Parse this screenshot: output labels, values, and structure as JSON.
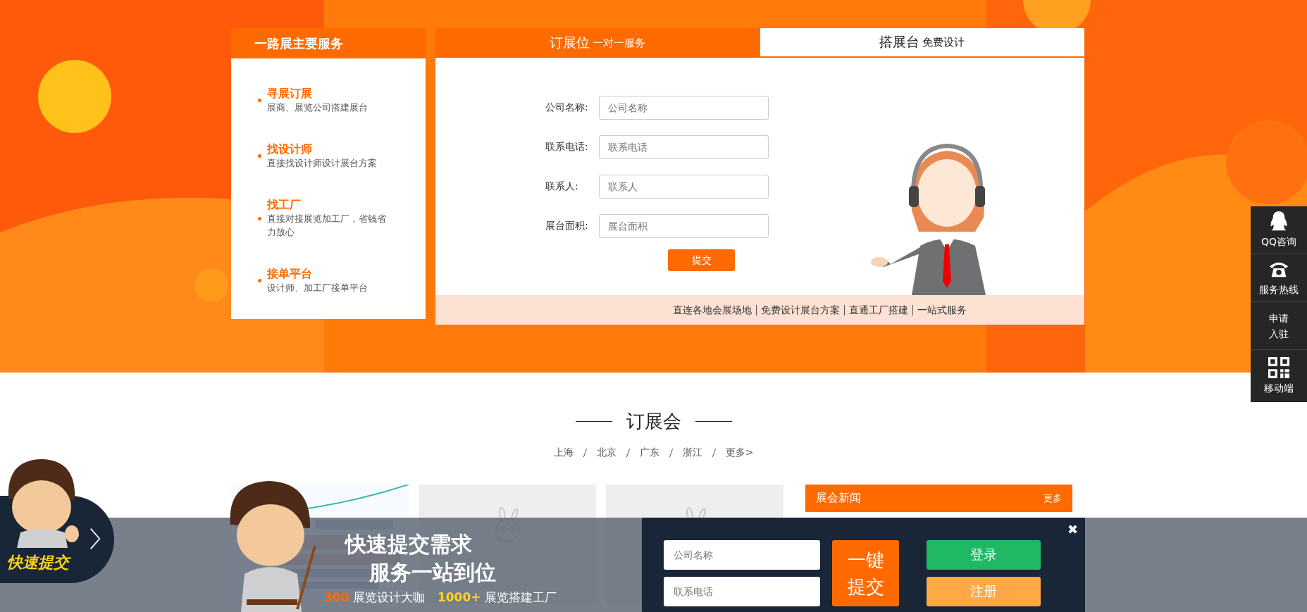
{
  "services_panel": {
    "title": "一路展主要服务",
    "items": [
      {
        "title": "寻展订展",
        "desc": "展商、展览公司搭建展台"
      },
      {
        "title": "找设计师",
        "desc": "直接找设计师设计展台方案"
      },
      {
        "title": "找工厂",
        "desc": "直接对接展览加工厂，省钱省力放心"
      },
      {
        "title": "接单平台",
        "desc": "设计师、加工厂接单平台"
      }
    ]
  },
  "booking_panel": {
    "tabs": [
      {
        "label": "订展位",
        "sub": "一对一服务",
        "selected": false
      },
      {
        "label": "搭展台",
        "sub": "免费设计",
        "selected": true
      }
    ],
    "fields": [
      {
        "label": "公司名称:",
        "placeholder": "公司名称"
      },
      {
        "label": "联系电话:",
        "placeholder": "联系电话"
      },
      {
        "label": "联系人:",
        "placeholder": "联系人"
      },
      {
        "label": "展台面积:",
        "placeholder": "展台面积"
      }
    ],
    "submit": "提交",
    "footer": [
      "直连各地会展场地",
      "免费设计展台方案",
      "直通工厂搭建",
      "一站式服务"
    ]
  },
  "side_bar": [
    {
      "kind": "qq",
      "lines": [
        "QQ咨询"
      ]
    },
    {
      "kind": "phone",
      "lines": [
        "服务热线"
      ]
    },
    {
      "kind": "text",
      "lines": [
        "申请",
        "入驻"
      ]
    },
    {
      "kind": "qrcode",
      "lines": [
        "移动端"
      ]
    }
  ],
  "section": {
    "title": "订展会",
    "cities": [
      "上海",
      "北京",
      "广东",
      "浙江",
      "更多>"
    ]
  },
  "cards": [
    {
      "kind": "picture"
    },
    {
      "kind": "placeholder"
    },
    {
      "kind": "placeholder"
    }
  ],
  "news": {
    "title": "展会新闻",
    "more": "更多"
  },
  "quick_bar": {
    "badge": "快速提交",
    "headline": [
      "快速提交需求",
      "服务一站到位"
    ],
    "stats": [
      {
        "number": "300",
        "label": "展览设计大咖",
        "color": "#ff6a00"
      },
      {
        "number": "1000+",
        "label": "展览搭建工厂",
        "color": "#ffd21f"
      }
    ],
    "fields": [
      {
        "placeholder": "公司名称"
      },
      {
        "placeholder": "联系电话"
      }
    ],
    "submit": [
      "一键",
      "提交"
    ],
    "buttons": [
      {
        "label": "登录",
        "kind": "login"
      },
      {
        "label": "注册",
        "kind": "register"
      }
    ],
    "close": "✖"
  }
}
